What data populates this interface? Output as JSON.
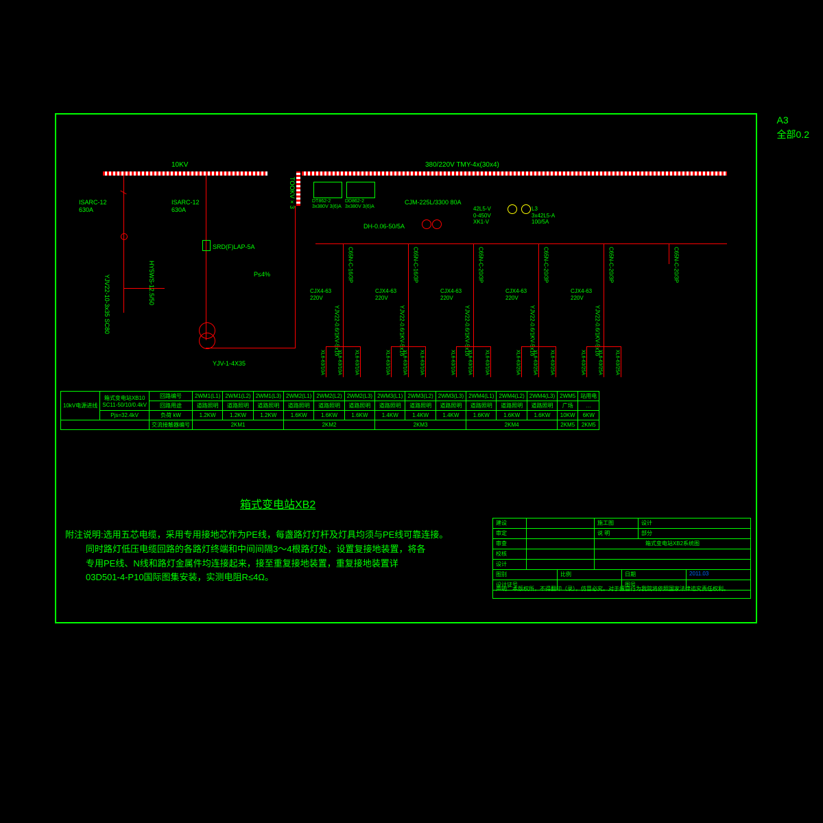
{
  "page_label": "A3",
  "page_scale": "全部0.2",
  "bus_left_label": "10KV",
  "bus_right_label": "380/220V  TMY-4x(30x4)",
  "bus_vert_label": "TOOKV×3",
  "left_side": {
    "isarc1": "ISARC-12\n630A",
    "isarc2": "ISARC-12\n630A",
    "arrester": "HY5WS-12.5/50",
    "cable1": "YJV22-10-3x35 SC80",
    "lap": "SRD(F)LAP-5A",
    "protect": "P≤4%",
    "cable2": "YJV-1-4X35"
  },
  "meters": {
    "m1": "DT862-2\n3x380V 3(6)A",
    "m2": "DD862-2\n3x380V 3(6)A",
    "cjm": "CJM-225L/3300 80A",
    "dh": "DH-0.06-50/5A",
    "volt": "42L5-V\n0-450V\nXK1-V",
    "amp": "L3\n3x42L5-A\n100/5A"
  },
  "feeders": [
    {
      "brk": "C65N-C-16/3P",
      "cont": "CJX4-63\n220V",
      "cable": "YJV22-0.6/1KV-5x16",
      "fuse": "XL6-63/10A"
    },
    {
      "brk": "C65N-C-16/3P",
      "cont": "CJX4-63\n220V",
      "cable": "YJV22-0.6/1KV-5x16",
      "fuse": "XL6-63/10A"
    },
    {
      "brk": "C65N-C-20/3P",
      "cont": "CJX4-63\n220V",
      "cable": "YJV22-0.6/1KV-5x16",
      "fuse": "XL6-63/10A"
    },
    {
      "brk": "C65N-C-20/3P",
      "cont": "CJX4-63\n220V",
      "cable": "YJV22-0.6/1KV-5x16",
      "fuse": "XL6-63/25A"
    },
    {
      "brk": "C65N-C-20/3P",
      "cont": "CJX4-63\n220V",
      "cable": "YJV22-0.6/1KV-5x16",
      "fuse": "XL6-63/25A"
    },
    {
      "brk": "C65N-C-20/3P",
      "cont": "",
      "cable": "",
      "fuse": ""
    }
  ],
  "table": {
    "hdr1": "10kV电源进线",
    "hdr2_a": "箱式变电站XB10",
    "hdr2_b": "SC11-50/10/0.4kV",
    "hdr2_c": "Pjs=32.4kV",
    "r0": [
      "回路编号",
      "2WM1(L1)",
      "2WM1(L2)",
      "2WM1(L3)",
      "2WM2(L1)",
      "2WM2(L2)",
      "2WM2(L3)",
      "2WM3(L1)",
      "2WM3(L2)",
      "2WM3(L3)",
      "2WM4(L1)",
      "2WM4(L2)",
      "2WM4(L3)",
      "2WM5",
      "站用电"
    ],
    "r1": [
      "回路用途",
      "道路照明",
      "道路照明",
      "道路照明",
      "道路照明",
      "道路照明",
      "道路照明",
      "道路照明",
      "道路照明",
      "道路照明",
      "道路照明",
      "道路照明",
      "道路照明",
      "广场",
      "…"
    ],
    "r2": [
      "负荷 kW",
      "1.2KW",
      "1.2KW",
      "1.2KW",
      "1.6KW",
      "1.6KW",
      "1.6KW",
      "1.4KW",
      "1.4KW",
      "1.4KW",
      "1.6KW",
      "1.6KW",
      "1.6KW",
      "10KW",
      "6KW"
    ],
    "r3": [
      "交流接触器编号",
      "2KM1",
      "",
      "",
      "2KM2",
      "",
      "",
      "2KM3",
      "",
      "",
      "2KM4",
      "",
      "",
      "2KM5",
      ""
    ]
  },
  "title": "箱式变电站XB2",
  "notes": [
    "附注说明:选用五芯电缆，采用专用接地芯作为PE线，每盏路灯灯杆及灯具均须与PE线可靠连接。",
    "同时路灯低压电缆回路的各路灯终端和中间间隔3～4根路灯处，设置复接地装置，将各",
    "专用PE线、N线和路灯金属件均连接起来，接至重复接地装置，重复接地装置详",
    "03D501-4-P10国际图集安装，实测电阻R≤4Ω。"
  ],
  "titleblock": {
    "rows": [
      [
        "建设",
        "",
        "施工图",
        "设计"
      ],
      [
        "审定",
        "",
        "说  明",
        "部分"
      ],
      [
        "审查",
        "",
        "",
        ""
      ],
      [
        "校核",
        "",
        "",
        ""
      ],
      [
        "设计",
        "",
        "",
        ""
      ],
      [
        "图别",
        "比例",
        "日期",
        "2011.03"
      ],
      [
        "设计证号",
        "",
        "图号",
        ""
      ]
    ],
    "drawing_title": "箱式变电站XB2系统图",
    "declaration": "声明：本版权所，不得翻印（录），仿冒必究。对于擅自行为我院将依照国家法律追究责任权利。"
  }
}
